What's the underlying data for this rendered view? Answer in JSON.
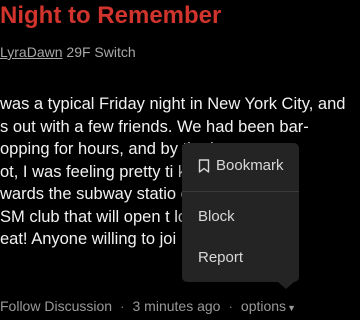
{
  "post": {
    "title": "Night to Remember",
    "author": "LyraDawn",
    "author_info": "29F Switch",
    "body_lines": [
      "was a typical Friday night in New York City, and",
      "s out with a few friends. We had been bar-",
      "opping for hours, and by                          the las",
      "ot, I was feeling pretty ti                       ked bac",
      "wards the subway statio                         oss a n",
      "SM club that will open                          t looks",
      "eat! Anyone willing to joi"
    ]
  },
  "footer": {
    "follow": "Follow Discussion",
    "separator": "·",
    "time": "3 minutes ago",
    "options": "options",
    "options_icon": "caret-down-icon"
  },
  "menu": {
    "bookmark_label": "Bookmark",
    "bookmark_icon": "bookmark-icon",
    "block_label": "Block",
    "report_label": "Report"
  },
  "colors": {
    "title": "#d0342c",
    "background": "#000000",
    "menu_bg": "#242424"
  }
}
